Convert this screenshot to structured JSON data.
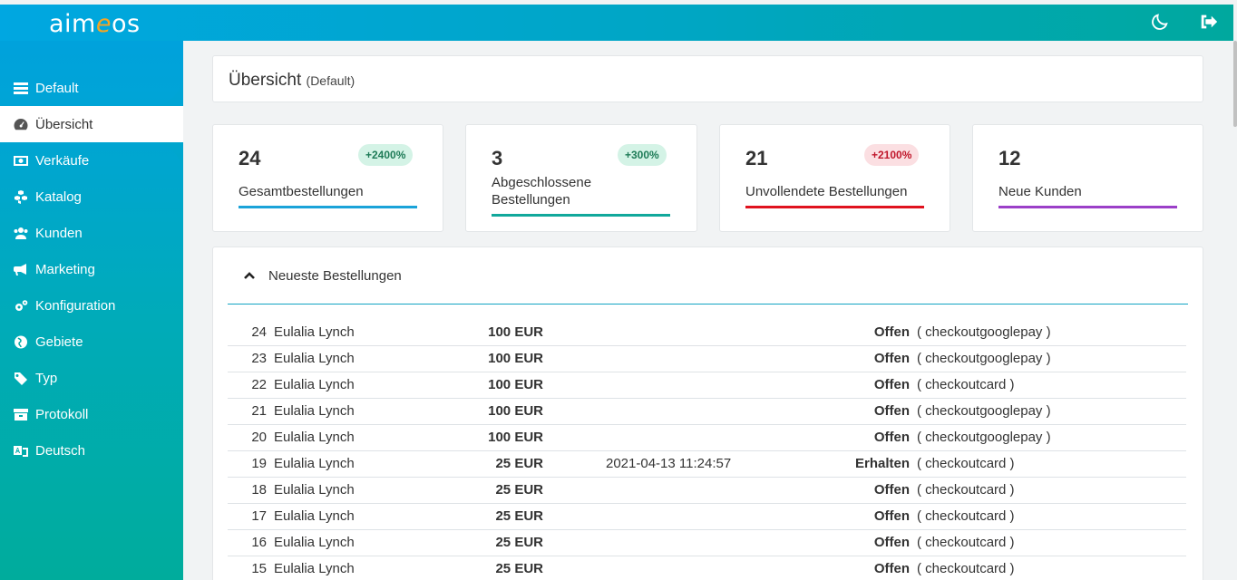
{
  "app": {
    "logo_left": "aim",
    "logo_mid": "e",
    "logo_right": "os"
  },
  "topbar": {
    "icons": [
      "moon-icon",
      "sign-out-icon"
    ]
  },
  "sidebar": {
    "items": [
      {
        "label": "Default",
        "icon": "server-icon"
      },
      {
        "label": "Übersicht",
        "icon": "dashboard-icon"
      },
      {
        "label": "Verkäufe",
        "icon": "money-icon"
      },
      {
        "label": "Katalog",
        "icon": "cubes-icon"
      },
      {
        "label": "Kunden",
        "icon": "users-icon"
      },
      {
        "label": "Marketing",
        "icon": "bullhorn-icon"
      },
      {
        "label": "Konfiguration",
        "icon": "cogs-icon"
      },
      {
        "label": "Gebiete",
        "icon": "globe-icon"
      },
      {
        "label": "Typ",
        "icon": "tag-icon"
      },
      {
        "label": "Protokoll",
        "icon": "archive-icon"
      },
      {
        "label": "Deutsch",
        "icon": "language-icon"
      }
    ]
  },
  "header": {
    "title": "Übersicht",
    "subtitle": "(Default)"
  },
  "stats": [
    {
      "value": "24",
      "label": "Gesamtbestellungen",
      "badge": "+2400%",
      "color": "#1aa3d9"
    },
    {
      "value": "3",
      "label_line1": "Abgeschlossene",
      "label_line2": "Bestellungen",
      "badge": "+300%",
      "color": "#11a89b"
    },
    {
      "value": "21",
      "label": "Unvollendete Bestellungen",
      "badge": "+2100%",
      "color": "#e0121e"
    },
    {
      "value": "12",
      "label": "Neue Kunden",
      "color": "#9b3fc8"
    }
  ],
  "orders": {
    "title": "Neueste Bestellungen",
    "rows": [
      {
        "id": "24",
        "name": "Eulalia Lynch",
        "price": "100 EUR",
        "date": "",
        "status": "Offen",
        "service": "( checkoutgooglepay )"
      },
      {
        "id": "23",
        "name": "Eulalia Lynch",
        "price": "100 EUR",
        "date": "",
        "status": "Offen",
        "service": "( checkoutgooglepay )"
      },
      {
        "id": "22",
        "name": "Eulalia Lynch",
        "price": "100 EUR",
        "date": "",
        "status": "Offen",
        "service": "( checkoutcard )"
      },
      {
        "id": "21",
        "name": "Eulalia Lynch",
        "price": "100 EUR",
        "date": "",
        "status": "Offen",
        "service": "( checkoutgooglepay )"
      },
      {
        "id": "20",
        "name": "Eulalia Lynch",
        "price": "100 EUR",
        "date": "",
        "status": "Offen",
        "service": "( checkoutgooglepay )"
      },
      {
        "id": "19",
        "name": "Eulalia Lynch",
        "price": "25 EUR",
        "date": "2021-04-13 11:24:57",
        "status": "Erhalten",
        "service": "( checkoutcard )"
      },
      {
        "id": "18",
        "name": "Eulalia Lynch",
        "price": "25 EUR",
        "date": "",
        "status": "Offen",
        "service": "( checkoutcard )"
      },
      {
        "id": "17",
        "name": "Eulalia Lynch",
        "price": "25 EUR",
        "date": "",
        "status": "Offen",
        "service": "( checkoutcard )"
      },
      {
        "id": "16",
        "name": "Eulalia Lynch",
        "price": "25 EUR",
        "date": "",
        "status": "Offen",
        "service": "( checkoutcard )"
      },
      {
        "id": "15",
        "name": "Eulalia Lynch",
        "price": "25 EUR",
        "date": "",
        "status": "Offen",
        "service": "( checkoutcard )"
      }
    ]
  }
}
